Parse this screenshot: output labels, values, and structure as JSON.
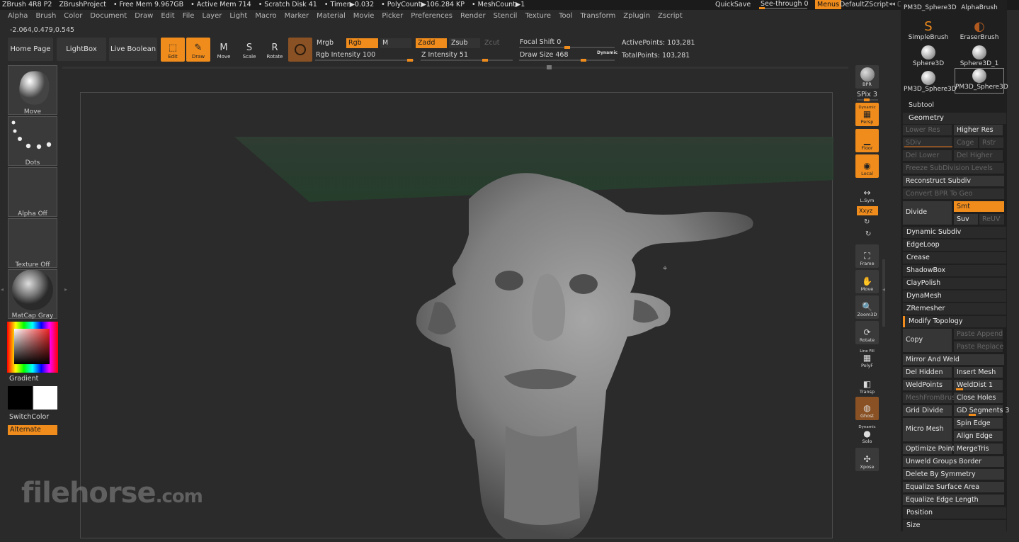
{
  "status_bar": {
    "app": "ZBrush 4R8 P2",
    "project": "ZBrushProject",
    "free_mem": "• Free Mem 9.967GB",
    "active_mem": "• Active Mem 714",
    "scratch": "• Scratch Disk 41",
    "timer": "• Timer▶0.032",
    "polycount": "• PolyCount▶106.284 KP",
    "meshcount": "• MeshCount▶1",
    "quicksave": "QuickSave",
    "see_through": "See-through  0",
    "see_through_value": 0,
    "menus": "Menus",
    "script": "DefaultZScript"
  },
  "menus": [
    "Alpha",
    "Brush",
    "Color",
    "Document",
    "Draw",
    "Edit",
    "File",
    "Layer",
    "Light",
    "Macro",
    "Marker",
    "Material",
    "Movie",
    "Picker",
    "Preferences",
    "Render",
    "Stencil",
    "Texture",
    "Tool",
    "Transform",
    "Zplugin",
    "Zscript"
  ],
  "coords": "-2.064,0.479,0.545",
  "top_buttons": {
    "home": "Home Page",
    "lightbox": "LightBox",
    "live_boolean": "Live Boolean"
  },
  "tools": {
    "edit": "Edit",
    "draw": "Draw",
    "move": "Move",
    "scale": "Scale",
    "rotate": "Rotate"
  },
  "draw_options": {
    "mrgb": "Mrgb",
    "rgb": "Rgb",
    "m": "M",
    "zadd": "Zadd",
    "zsub": "Zsub",
    "zcut": "Zcut",
    "rgb_intensity": "Rgb Intensity 100",
    "rgb_intensity_value": 100,
    "z_intensity": "Z Intensity 51",
    "z_intensity_value": 51,
    "focal_shift": "Focal Shift 0",
    "focal_shift_value": 0,
    "draw_size": "Draw Size 468",
    "draw_size_value": 468,
    "dynamic": "Dynamic",
    "active_points": "ActivePoints: 103,281",
    "total_points": "TotalPoints: 103,281"
  },
  "left_panel": {
    "brush": "Move",
    "stroke": "Dots",
    "alpha": "Alpha Off",
    "texture": "Texture Off",
    "material": "MatCap Gray",
    "gradient": "Gradient",
    "switch_color": "SwitchColor",
    "alternate": "Alternate"
  },
  "right_toolbar": {
    "bpr": "BPR",
    "spix": "SPix 3",
    "persp": "Persp",
    "persp_top": "Dynamic",
    "floor": "Floor",
    "local": "Local",
    "lsym": "L.Sym",
    "xyz": "Xxyz",
    "frame": "Frame",
    "move": "Move",
    "zoom3d": "Zoom3D",
    "rotate": "Rotate",
    "line_fill": "Line Fill",
    "polyf": "PolyF",
    "transp": "Transp",
    "ghost": "Ghost",
    "dynamic": "Dynamic",
    "solo": "Solo",
    "xpose": "Xpose"
  },
  "brush_palette": {
    "row0": [
      "PM3D_Sphere3D",
      "AlphaBrush"
    ],
    "row1": [
      "SimpleBrush",
      "EraserBrush"
    ],
    "row2": [
      "Sphere3D",
      "Sphere3D_1"
    ],
    "row3": [
      "PM3D_Sphere3D",
      "PM3D_Sphere3D"
    ]
  },
  "subtool": "Subtool",
  "geometry": {
    "header": "Geometry",
    "lower_res": "Lower Res",
    "higher_res": "Higher Res",
    "sdiv": "SDiv",
    "cage": "Cage",
    "rstr": "Rstr",
    "del_lower": "Del Lower",
    "del_higher": "Del Higher",
    "freeze": "Freeze SubDivision Levels",
    "reconstruct": "Reconstruct Subdiv",
    "convert_bpr": "Convert BPR To Geo",
    "divide": "Divide",
    "smt": "Smt",
    "suv": "Suv",
    "reuv": "ReUV",
    "dynamic_subdiv": "Dynamic Subdiv",
    "edgeloop": "EdgeLoop",
    "crease": "Crease",
    "shadowbox": "ShadowBox",
    "claypolish": "ClayPolish",
    "dynamesh": "DynaMesh",
    "zremesher": "ZRemesher",
    "modify_topology": "Modify Topology",
    "copy": "Copy",
    "paste_append": "Paste Append",
    "paste_replace": "Paste Replace",
    "mirror_weld": "Mirror And Weld",
    "del_hidden": "Del Hidden",
    "insert_mesh": "Insert Mesh",
    "weldpoints": "WeldPoints",
    "welddist": "WeldDist 1",
    "meshfrombrush": "MeshFromBrush",
    "close_holes": "Close Holes",
    "grid_divide": "Grid Divide",
    "gd_segments": "GD Segments 3",
    "micro_mesh": "Micro Mesh",
    "spin_edge": "Spin Edge",
    "align_edge": "Align Edge",
    "optimize_points": "Optimize Points",
    "mergetris": "MergeTris",
    "unweld": "Unweld Groups Border",
    "delete_symmetry": "Delete By Symmetry",
    "equalize_area": "Equalize Surface Area",
    "equalize_edge": "Equalize Edge Length",
    "position": "Position",
    "size": "Size"
  },
  "watermark": {
    "main": "filehorse",
    "suffix": ".com"
  },
  "colors": {
    "accent": "#f08c1c",
    "bg": "#2a2a2a",
    "panel": "#1f1f1f"
  }
}
